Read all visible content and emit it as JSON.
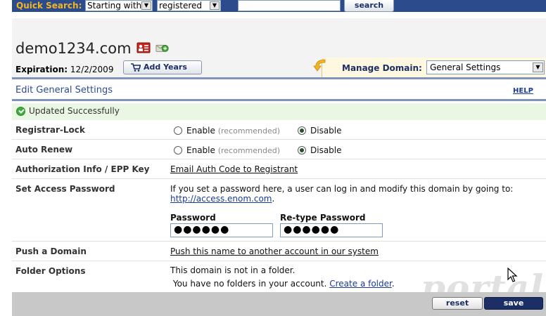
{
  "quick_search": {
    "label": "Quick Search:",
    "mode_selected": "Starting with",
    "status_selected": "registered",
    "query": "",
    "button": "search"
  },
  "domain": {
    "name": "demo1234.com",
    "expiration_label": "Expiration:",
    "expiration_date": "12/2/2009",
    "add_years_label": "Add Years",
    "manage_label": "Manage Domain:",
    "manage_selected": "General Settings"
  },
  "section": {
    "title": "Edit General Settings",
    "help": "HELP"
  },
  "status": {
    "message": "Updated Successfully",
    "color": "#3fae3a"
  },
  "settings": {
    "registrar_lock": {
      "label": "Registrar-Lock",
      "enable": "Enable",
      "recommended": "(recommended)",
      "disable": "Disable",
      "selected": "Disable"
    },
    "auto_renew": {
      "label": "Auto Renew",
      "enable": "Enable",
      "recommended": "(recommended)",
      "disable": "Disable",
      "selected": "Disable"
    },
    "auth_info": {
      "label": "Authorization Info / EPP Key",
      "link": "Email Auth Code to Registrant"
    },
    "access_password": {
      "label": "Set Access Password",
      "description": "If you set a password here, a user can log in and modify this domain by going to:",
      "url": "http://access.enom.com",
      "url_suffix": ".",
      "password_label": "Password",
      "password_value": "●●●●●●",
      "retype_label": "Re-type Password",
      "retype_value": "●●●●●●"
    },
    "push_domain": {
      "label": "Push a Domain",
      "link": "Push this name to another account in our system"
    },
    "folder_options": {
      "label": "Folder Options",
      "line1": "This domain is not in a folder.",
      "line2": "You have no folders in your account.",
      "link": "Create a folder",
      "link_suffix": "."
    }
  },
  "footer": {
    "reset": "reset",
    "save": "save"
  },
  "watermark": "portal",
  "colors": {
    "nav_blue": "#2b4b8c",
    "quick_search_label": "#f2b422",
    "save_button": "#1b2f66",
    "success_bg": "#eaf7e4"
  }
}
